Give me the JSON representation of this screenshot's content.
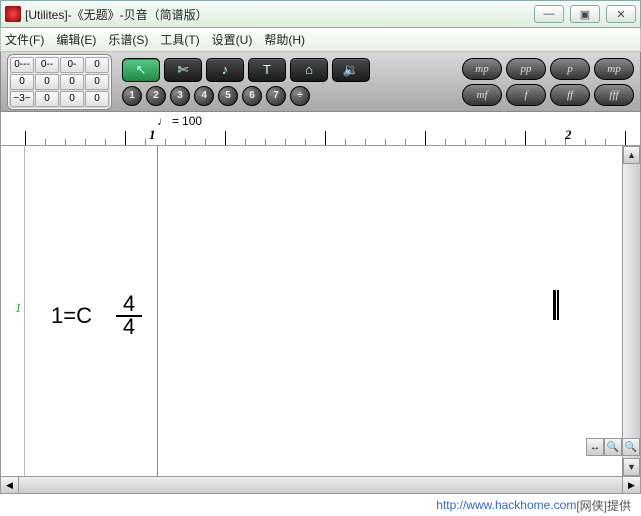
{
  "window": {
    "title": "[Utilites]-《无题》-贝音（简谱版）",
    "buttons": {
      "min": "—",
      "max": "▣",
      "close": "✕"
    }
  },
  "menu": [
    "文件(F)",
    "编辑(E)",
    "乐谱(S)",
    "工具(T)",
    "设置(U)",
    "帮助(H)"
  ],
  "notepad": [
    "0---",
    "0--",
    "0-",
    "0",
    "0",
    "0",
    "0",
    "0",
    "~3~",
    "0",
    "0",
    "0"
  ],
  "tool_icons": {
    "arrow": "↖",
    "cut": "✄",
    "tuning": "♪",
    "text": "T",
    "lyric": "⌂",
    "sound": "🔉"
  },
  "number_row": [
    "1",
    "2",
    "3",
    "4",
    "5",
    "6",
    "7",
    "÷"
  ],
  "dynamics_top": [
    "mp",
    "pp",
    "p",
    "mp"
  ],
  "dynamics_bottom": [
    "mf",
    "f",
    "ff",
    "fff"
  ],
  "tempo": {
    "note": "♩",
    "eq": "=",
    "value": "100"
  },
  "ruler": {
    "m1": "1",
    "m2": "2"
  },
  "score": {
    "line": "1",
    "key": "1=C",
    "ts_num": "4",
    "ts_den": "4"
  },
  "zoom": {
    "in": "🔍",
    "out": "🔍"
  },
  "footer": {
    "url": "http://www.hackhome.com",
    "tail": "[网侠]提供"
  }
}
